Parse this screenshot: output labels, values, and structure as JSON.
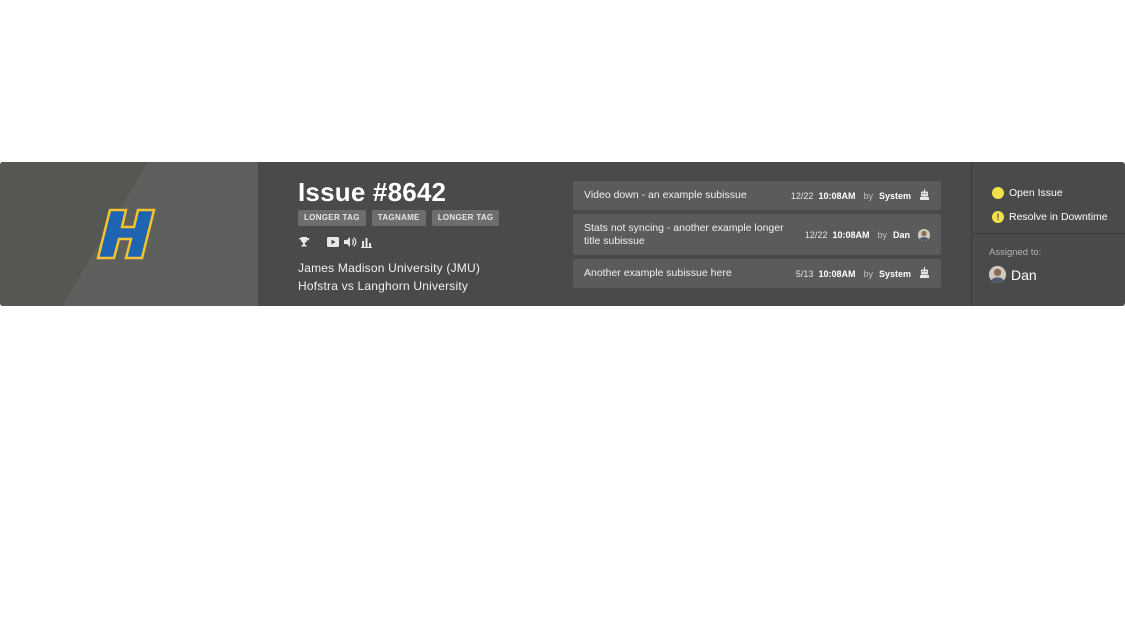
{
  "issue": {
    "title": "Issue #8642",
    "tags": [
      "LONGER TAG",
      "TAGNAME",
      "LONGER TAG"
    ],
    "icons": [
      "trophy-icon",
      "video-icon",
      "volume-icon",
      "bar-chart-icon"
    ],
    "teams": {
      "line1": "James Madison University (JMU)",
      "line2": "Hofstra vs Langhorn University"
    },
    "logo_letter": "H",
    "logo_colors": {
      "fill": "#1f64b0",
      "outline": "#f2c230"
    }
  },
  "subissues": [
    {
      "title": "Video down - an example subissue",
      "date": "12/22",
      "time": "10:08AM",
      "by": "by",
      "user": "System",
      "icon": "robot-icon"
    },
    {
      "title": "Stats not syncing - another example longer title subissue",
      "date": "12/22",
      "time": "10:08AM",
      "by": "by",
      "user": "Dan",
      "icon": "avatar"
    },
    {
      "title": "Another example subissue here",
      "date": "5/13",
      "time": "10:08AM",
      "by": "by",
      "user": "System",
      "icon": "robot-icon"
    }
  ],
  "actions": {
    "open_issue": "Open Issue",
    "resolve": "Resolve in Downtime",
    "open_color": "#f2e24a",
    "resolve_color": "#f2e24a",
    "resolve_glyph": "!"
  },
  "assigned": {
    "label": "Assigned to:",
    "name": "Dan"
  }
}
